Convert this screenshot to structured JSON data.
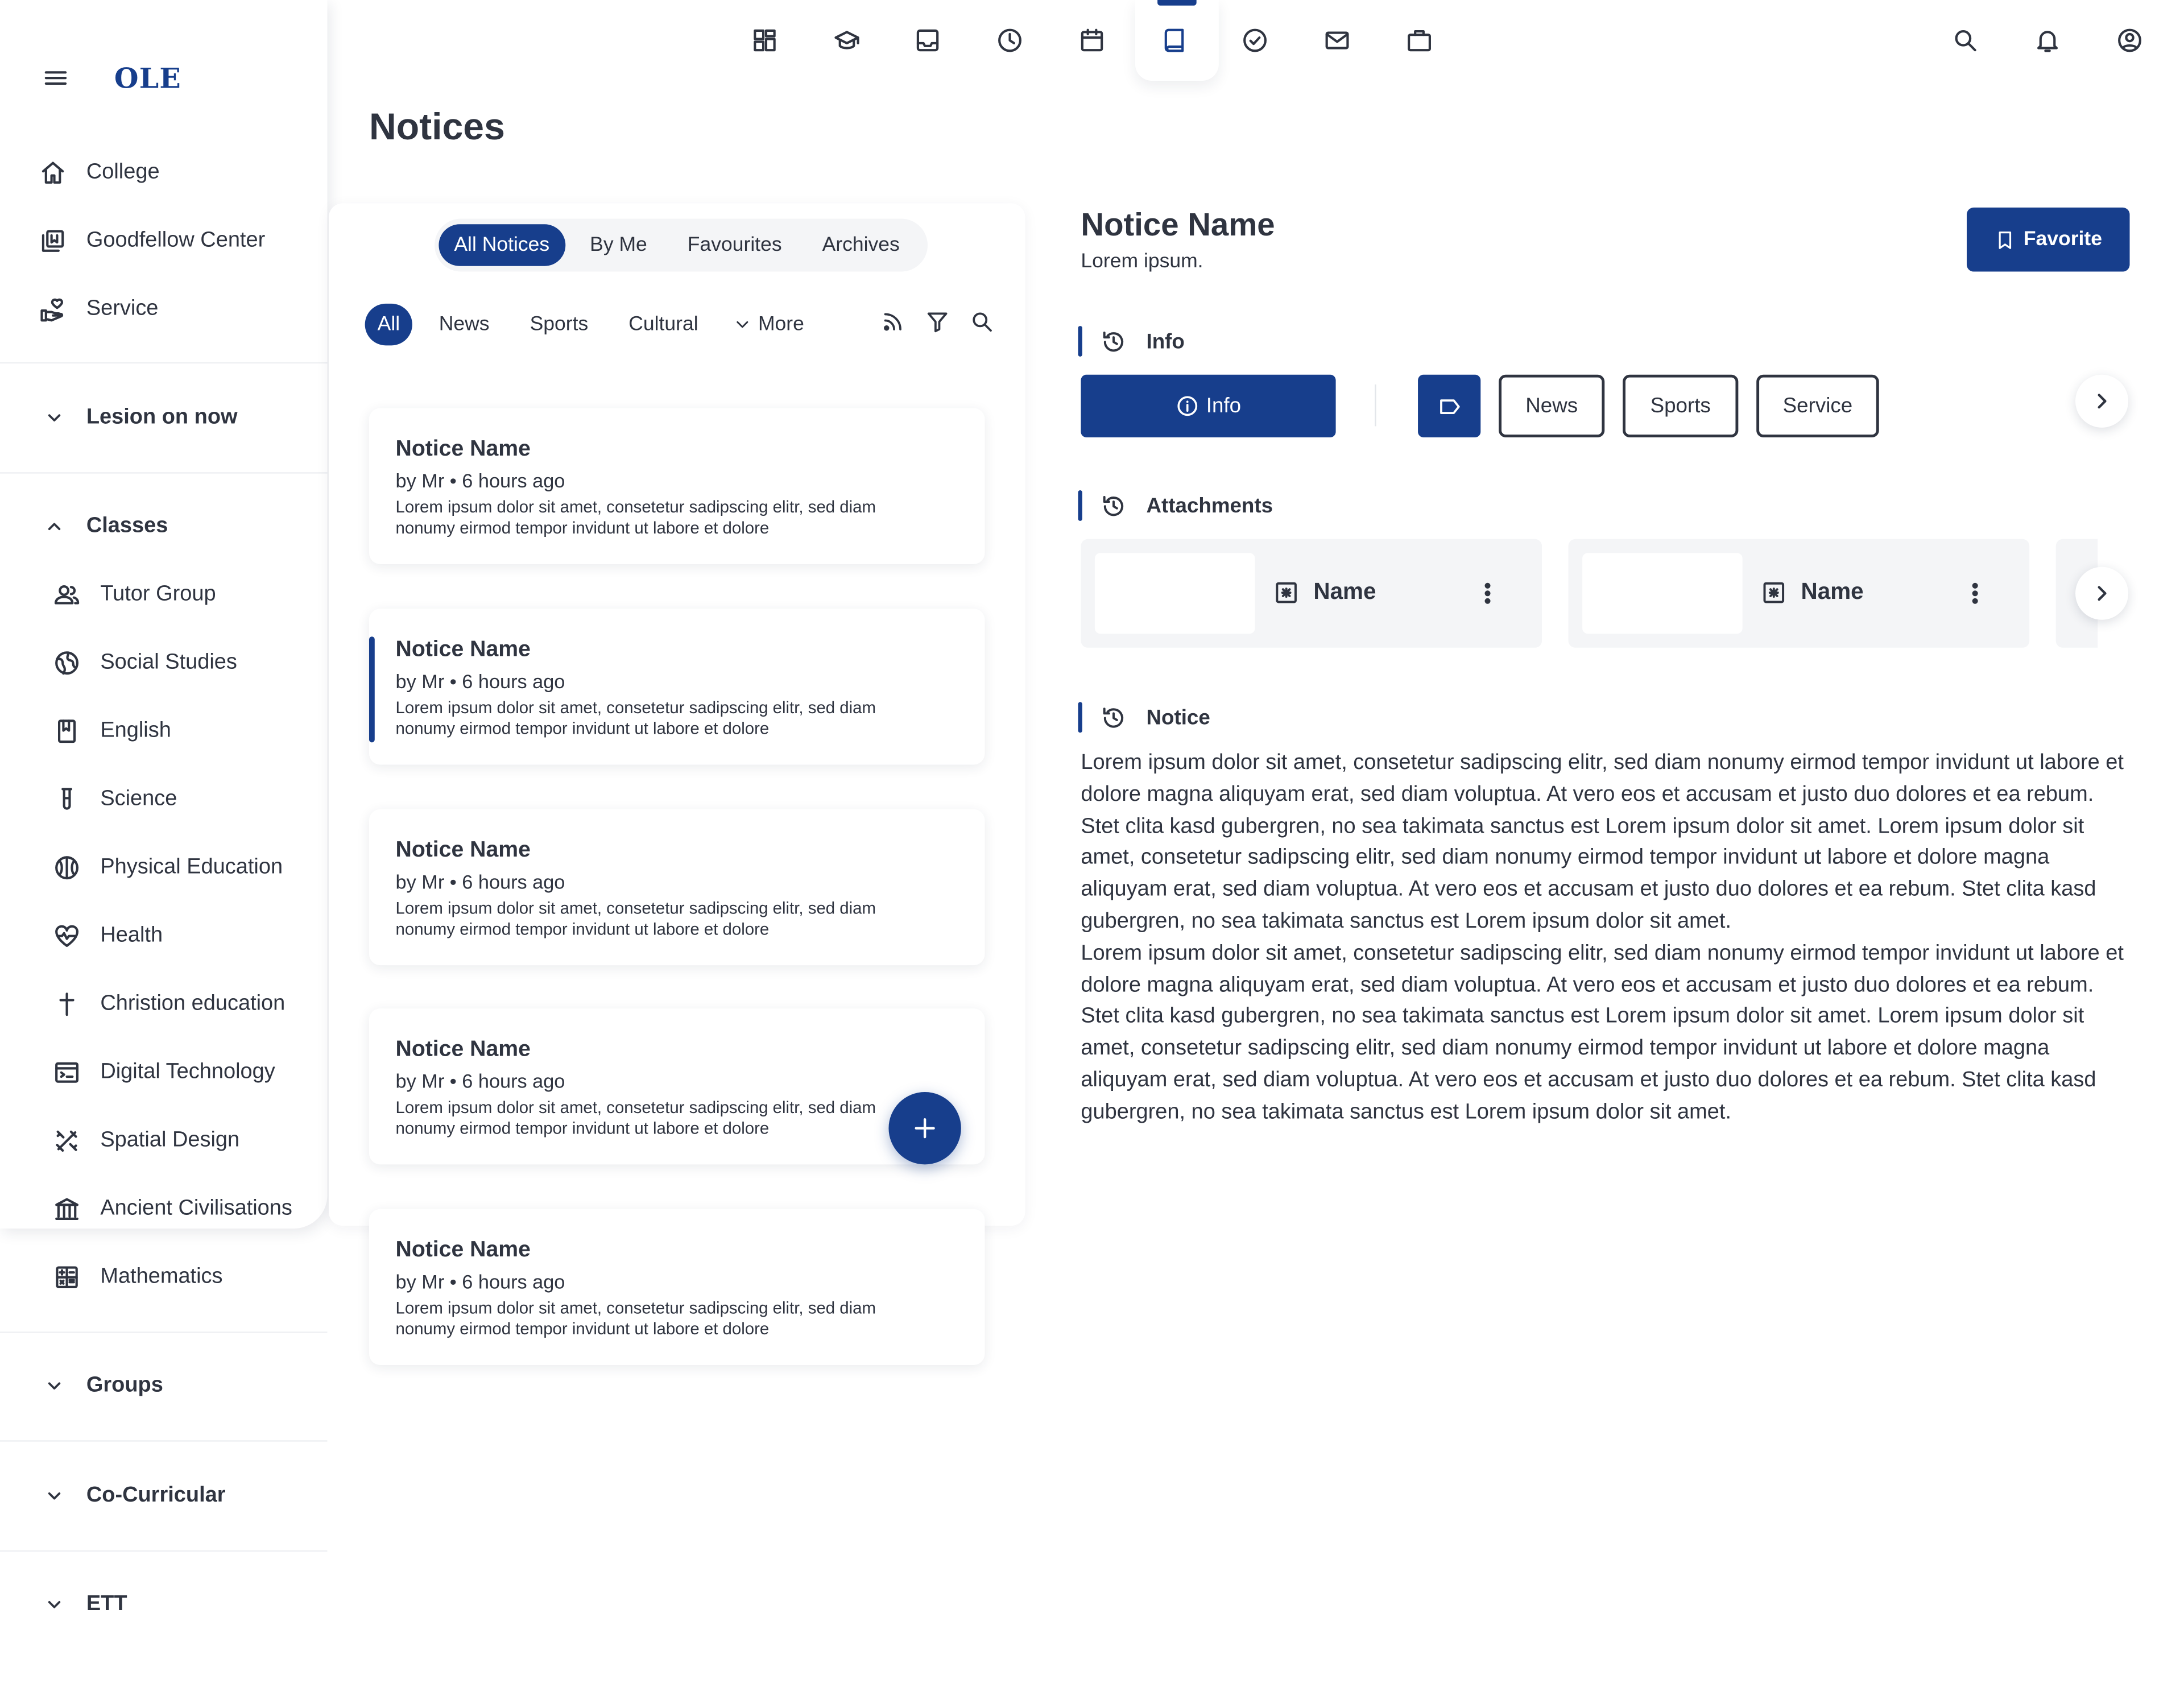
{
  "app": {
    "logo": "OLE"
  },
  "sidebar": {
    "main_items": [
      {
        "label": "College",
        "icon": "home-icon"
      },
      {
        "label": "Goodfellow Center",
        "icon": "library-icon"
      },
      {
        "label": "Service",
        "icon": "hand-heart-icon"
      }
    ],
    "sections": {
      "lesion": "Lesion on now",
      "classes": "Classes",
      "groups": "Groups",
      "cocurricular": "Co-Curricular",
      "ett": "ETT"
    },
    "classes": [
      {
        "label": "Tutor Group",
        "icon": "people-icon"
      },
      {
        "label": "Social Studies",
        "icon": "globe-icon"
      },
      {
        "label": "English",
        "icon": "book-icon"
      },
      {
        "label": "Science",
        "icon": "test-tube-icon"
      },
      {
        "label": "Physical Education",
        "icon": "ball-icon"
      },
      {
        "label": "Health",
        "icon": "heart-pulse-icon"
      },
      {
        "label": "Christion education",
        "icon": "cross-icon"
      },
      {
        "label": "Digital Technology",
        "icon": "terminal-icon"
      },
      {
        "label": "Spatial Design",
        "icon": "design-tools-icon"
      },
      {
        "label": "Ancient Civilisations",
        "icon": "museum-icon"
      },
      {
        "label": "Mathematics",
        "icon": "calculator-icon"
      }
    ]
  },
  "topnav": {
    "icons": [
      "dashboard-icon",
      "graduation-cap-icon",
      "inbox-icon",
      "clock-icon",
      "calendar-icon",
      "notice-book-icon",
      "check-circle-icon",
      "mail-icon",
      "briefcase-icon"
    ],
    "active_index": 5,
    "right_icons": [
      "search-icon",
      "bell-icon",
      "account-icon"
    ]
  },
  "page": {
    "title": "Notices"
  },
  "list": {
    "segments": [
      "All Notices",
      "By Me",
      "Favourites",
      "Archives"
    ],
    "filters": [
      "All",
      "News",
      "Sports",
      "Cultural"
    ],
    "more_label": "More",
    "cards": [
      {
        "name": "Notice Name",
        "by": "by Mr • 6 hours ago",
        "excerpt": "Lorem ipsum dolor sit amet, consetetur sadipscing elitr, sed diam nonumy eirmod tempor invidunt ut labore et dolore",
        "selected": false
      },
      {
        "name": "Notice Name",
        "by": "by Mr • 6 hours ago",
        "excerpt": "Lorem ipsum dolor sit amet, consetetur sadipscing elitr, sed diam nonumy eirmod tempor invidunt ut labore et dolore",
        "selected": true
      },
      {
        "name": "Notice Name",
        "by": "by Mr • 6 hours ago",
        "excerpt": "Lorem ipsum dolor sit amet, consetetur sadipscing elitr, sed diam nonumy eirmod tempor invidunt ut labore et dolore",
        "selected": false
      },
      {
        "name": "Notice Name",
        "by": "by Mr • 6 hours ago",
        "excerpt": "Lorem ipsum dolor sit amet, consetetur sadipscing elitr, sed diam nonumy eirmod tempor invidunt ut labore et dolore",
        "selected": false
      },
      {
        "name": "Notice Name",
        "by": "by Mr • 6 hours ago",
        "excerpt": "Lorem ipsum dolor sit amet, consetetur sadipscing elitr, sed diam nonumy eirmod tempor invidunt ut labore et dolore",
        "selected": false
      }
    ],
    "fab_icon": "plus-icon"
  },
  "detail": {
    "title": "Notice Name",
    "subtitle": "Lorem ipsum.",
    "favorite_label": "Favorite",
    "info_section": "Info",
    "info_button": "Info",
    "tags": [
      "News",
      "Sports",
      "Service"
    ],
    "attachments_section": "Attachments",
    "attachments": [
      {
        "name": "Name"
      },
      {
        "name": "Name"
      }
    ],
    "notice_section": "Notice",
    "paragraphs": [
      "Lorem ipsum dolor sit amet, consetetur sadipscing elitr, sed diam nonumy eirmod tempor invidunt ut labore et dolore magna aliquyam erat, sed diam voluptua. At vero eos et accusam et justo duo dolores et ea rebum. Stet clita kasd gubergren, no sea takimata sanctus est Lorem ipsum dolor sit amet. Lorem ipsum dolor sit amet, consetetur sadipscing elitr, sed diam nonumy eirmod tempor invidunt ut labore et dolore magna aliquyam erat, sed diam voluptua. At vero eos et accusam et justo duo dolores et ea rebum. Stet clita kasd gubergren, no sea takimata sanctus est Lorem ipsum dolor sit amet.",
      "Lorem ipsum dolor sit amet, consetetur sadipscing elitr, sed diam nonumy eirmod tempor invidunt ut labore et dolore magna aliquyam erat, sed diam voluptua. At vero eos et accusam et justo duo dolores et ea rebum. Stet clita kasd gubergren, no sea takimata sanctus est Lorem ipsum dolor sit amet. Lorem ipsum dolor sit amet, consetetur sadipscing elitr, sed diam nonumy eirmod tempor invidunt ut labore et dolore magna aliquyam erat, sed diam voluptua. At vero eos et accusam et justo duo dolores et ea rebum. Stet clita kasd gubergren, no sea takimata sanctus est Lorem ipsum dolor sit amet."
    ]
  },
  "colors": {
    "primary": "#173e8c",
    "text": "#2f3440",
    "surface": "#f4f5f7"
  }
}
